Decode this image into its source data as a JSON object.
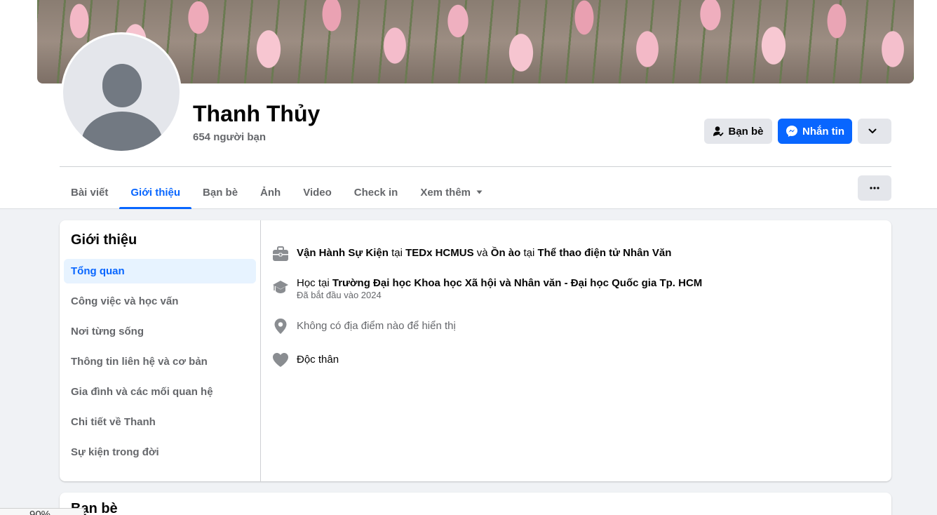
{
  "profile": {
    "name": "Thanh Thủy",
    "friends_count": "654 người bạn"
  },
  "actions": {
    "friends_label": "Bạn bè",
    "message_label": "Nhắn tin"
  },
  "tabs": [
    {
      "label": "Bài viết"
    },
    {
      "label": "Giới thiệu",
      "active": true
    },
    {
      "label": "Bạn bè"
    },
    {
      "label": "Ảnh"
    },
    {
      "label": "Video"
    },
    {
      "label": "Check in"
    },
    {
      "label": "Xem thêm"
    }
  ],
  "about": {
    "title": "Giới thiệu",
    "nav": [
      {
        "label": "Tổng quan",
        "active": true
      },
      {
        "label": "Công việc và học vấn"
      },
      {
        "label": "Nơi từng sống"
      },
      {
        "label": "Thông tin liên hệ và cơ bản"
      },
      {
        "label": "Gia đình và các mối quan hệ"
      },
      {
        "label": "Chi tiết về Thanh"
      },
      {
        "label": "Sự kiện trong đời"
      }
    ],
    "work": {
      "role1": "Vận Hành Sự Kiện",
      "at1": "tại",
      "org1": "TEDx HCMUS",
      "and": "và",
      "role2": "Ồn ào",
      "at2": "tại",
      "org2": "Thể thao điện tử Nhân Văn"
    },
    "education": {
      "prefix": "Học tại",
      "school": "Trường Đại học Khoa học Xã hội và Nhân văn - Đại học Quốc gia Tp. HCM",
      "started": "Đã bắt đầu vào 2024"
    },
    "location": "Không có địa điểm nào để hiển thị",
    "relationship": "Độc thân"
  },
  "friends_section": {
    "title": "Bạn bè"
  },
  "zoom": "90%"
}
